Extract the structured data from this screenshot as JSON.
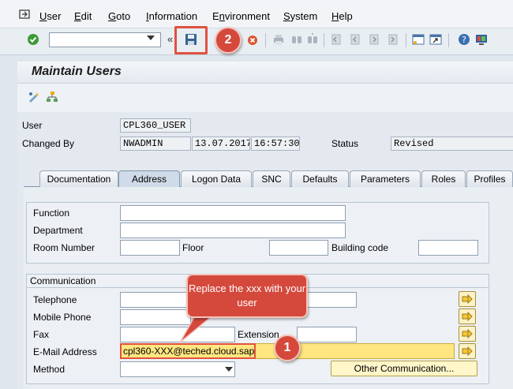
{
  "menubar": {
    "items": [
      "User",
      "Edit",
      "Goto",
      "Information",
      "Environment",
      "System",
      "Help"
    ],
    "underline": [
      "U",
      "E",
      "G",
      "I",
      "n",
      "S",
      "H"
    ]
  },
  "toolbar": {
    "command_value": "",
    "nav_back_glyph": "«"
  },
  "title": "Maintain Users",
  "header": {
    "user_label": "User",
    "user_value": "CPL360_USER",
    "changed_by_label": "Changed By",
    "changed_by_value": "NWADMIN",
    "changed_date": "13.07.2017",
    "changed_time": "16:57:30",
    "status_label": "Status",
    "status_value": "Revised"
  },
  "tabs": [
    "Documentation",
    "Address",
    "Logon Data",
    "SNC",
    "Defaults",
    "Parameters",
    "Roles",
    "Profiles"
  ],
  "active_tab": "Address",
  "person_group": {
    "function_label": "Function",
    "department_label": "Department",
    "room_label": "Room Number",
    "floor_label": "Floor",
    "building_label": "Building code"
  },
  "communication": {
    "title": "Communication",
    "telephone_label": "Telephone",
    "mobile_label": "Mobile Phone",
    "fax_label": "Fax",
    "extension_label": "Extension",
    "email_label": "E-Mail Address",
    "email_value": "cpl360-XXX@teched.cloud.sap",
    "method_label": "Method",
    "other_comm_label": "Other Communication..."
  },
  "annotations": {
    "callout_1": "1",
    "callout_2": "2",
    "note": "Replace the xxx with your user"
  },
  "colors": {
    "annotation_red": "#d4493c",
    "email_highlight": "#ffe680",
    "background": "#dfe6ee"
  },
  "icons": [
    "sap-menu-icon",
    "enter-check-icon",
    "save-icon",
    "back-icon",
    "exit-icon",
    "cancel-icon",
    "print-icon",
    "find-icon",
    "find-next-icon",
    "first-page-icon",
    "prev-page-icon",
    "next-page-icon",
    "last-page-icon",
    "new-session-icon",
    "shortcut-icon",
    "help-icon",
    "layout-icon",
    "change-display-icon",
    "hierarchy-icon"
  ]
}
